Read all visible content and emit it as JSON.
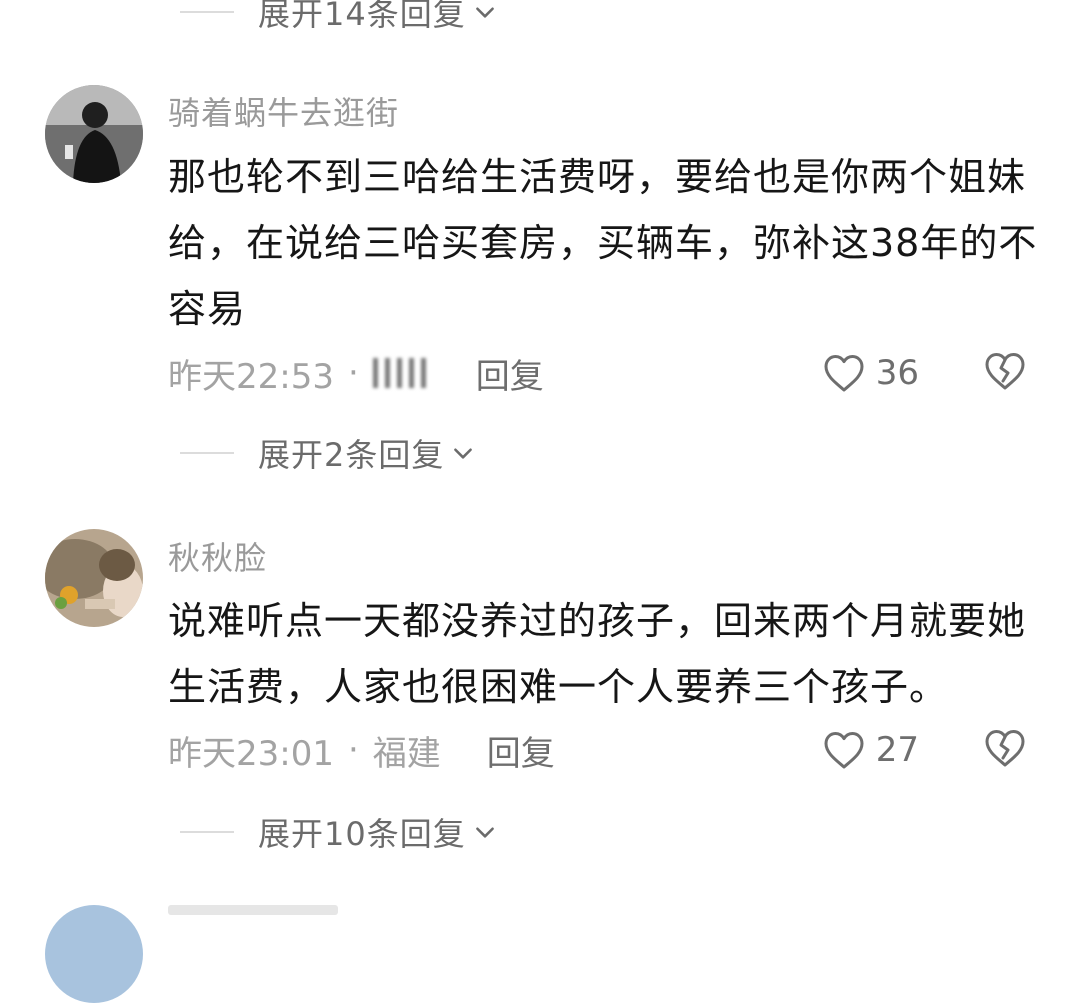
{
  "top_expand": {
    "label": "展开14条回复"
  },
  "comments": [
    {
      "username": "骑着蜗牛去逛街",
      "content": "那也轮不到三哈给生活费呀，要给也是你两个姐妹给，在说给三哈买套房，买辆车，弥补这38年的不容易",
      "time": "昨天22:53",
      "separator": "·",
      "location": "",
      "reply_label": "回复",
      "likes": "36",
      "expand_label": "展开2条回复"
    },
    {
      "username": "秋秋脸",
      "content": "说难听点一天都没养过的孩子，回来两个月就要她生活费，人家也很困难一个人要养三个孩子。",
      "time": "昨天23:01",
      "separator": "·",
      "location": "福建",
      "reply_label": "回复",
      "likes": "27",
      "expand_label": "展开10条回复"
    }
  ],
  "icons": {
    "like": "heart-outline-icon",
    "dislike": "broken-heart-icon",
    "expand": "chevron-down-icon"
  },
  "colors": {
    "username": "#9a9a9a",
    "content": "#161616",
    "meta": "#a3a3a3",
    "action": "#6e6e6e"
  }
}
